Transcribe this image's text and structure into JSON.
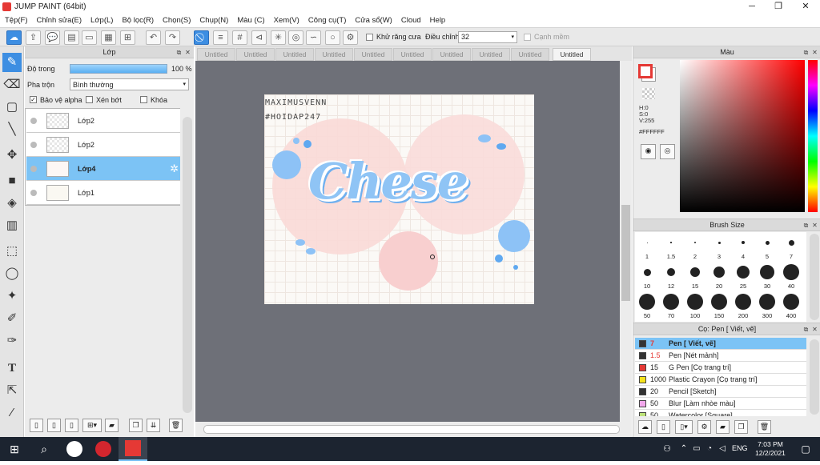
{
  "app": {
    "title": "JUMP PAINT (64bit)"
  },
  "menu": [
    "Tệp(F)",
    "Chỉnh sửa(E)",
    "Lớp(L)",
    "Bộ lọc(R)",
    "Chọn(S)",
    "Chụp(N)",
    "Màu (C)",
    "Xem(V)",
    "Công cụ(T)",
    "Cửa sổ(W)",
    "Cloud",
    "Help"
  ],
  "toolbar": {
    "antialias_label": "Khử răng cưa",
    "adjust_label": "Điều chỉnh",
    "adjust_value": "32",
    "edge_label": "Cạnh mềm"
  },
  "tabs": [
    "Untitled",
    "Untitled",
    "Untitled",
    "Untitled",
    "Untitled",
    "Untitled",
    "Untitled",
    "Untitled",
    "Untitled",
    "Untitled"
  ],
  "layer_panel": {
    "title": "Lớp",
    "opacity_label": "Độ trong",
    "opacity_value": "100 %",
    "blend_label": "Pha trộn",
    "blend_value": "Bình thường",
    "protect_alpha": "Bảo vệ alpha",
    "clip": "Xén bớt",
    "lock": "Khóa",
    "layers": [
      "Lớp2",
      "Lớp2",
      "Lớp4",
      "Lớp1"
    ],
    "selected_index": 2
  },
  "artwork": {
    "watermark_line1": "MAXIMUSVENN",
    "watermark_line2": "#HOIDAP247",
    "word": "Chese"
  },
  "color_panel": {
    "title": "Màu",
    "h": "H:0",
    "s": "S:0",
    "v": "V:255",
    "hex": "#FFFFFF",
    "colors": {
      "primary": "#e53935",
      "hue_top": "#ff0000"
    }
  },
  "brush_size": {
    "title": "Brush Size",
    "sizes": [
      "1",
      "1.5",
      "2",
      "3",
      "4",
      "5",
      "7",
      "10",
      "12",
      "15",
      "20",
      "25",
      "30",
      "40",
      "50",
      "70",
      "100",
      "150",
      "200",
      "300",
      "400"
    ]
  },
  "brush_list": {
    "title": "Cọ: Pen [ Viết, vẽ]",
    "items": [
      {
        "size": "7",
        "name": "Pen [ Viết, vẽ]",
        "color": "#333333"
      },
      {
        "size": "1.5",
        "name": "Pen [Nét mảnh]",
        "color": "#333333"
      },
      {
        "size": "15",
        "name": "G Pen [Cọ trang trí]",
        "color": "#e53935"
      },
      {
        "size": "1000",
        "name": "Plastic Crayon [Cọ trang trí]",
        "color": "#f5e21c"
      },
      {
        "size": "20",
        "name": "Pencil [Sketch]",
        "color": "#333333"
      },
      {
        "size": "50",
        "name": "Blur [Làm nhòe màu]",
        "color": "#f2a8ec"
      },
      {
        "size": "50",
        "name": "Watercolor [Square]",
        "color": "#bde27a"
      }
    ],
    "selected_index": 0
  },
  "taskbar": {
    "lang": "ENG",
    "time": "7:03 PM",
    "date": "12/2/2021"
  }
}
